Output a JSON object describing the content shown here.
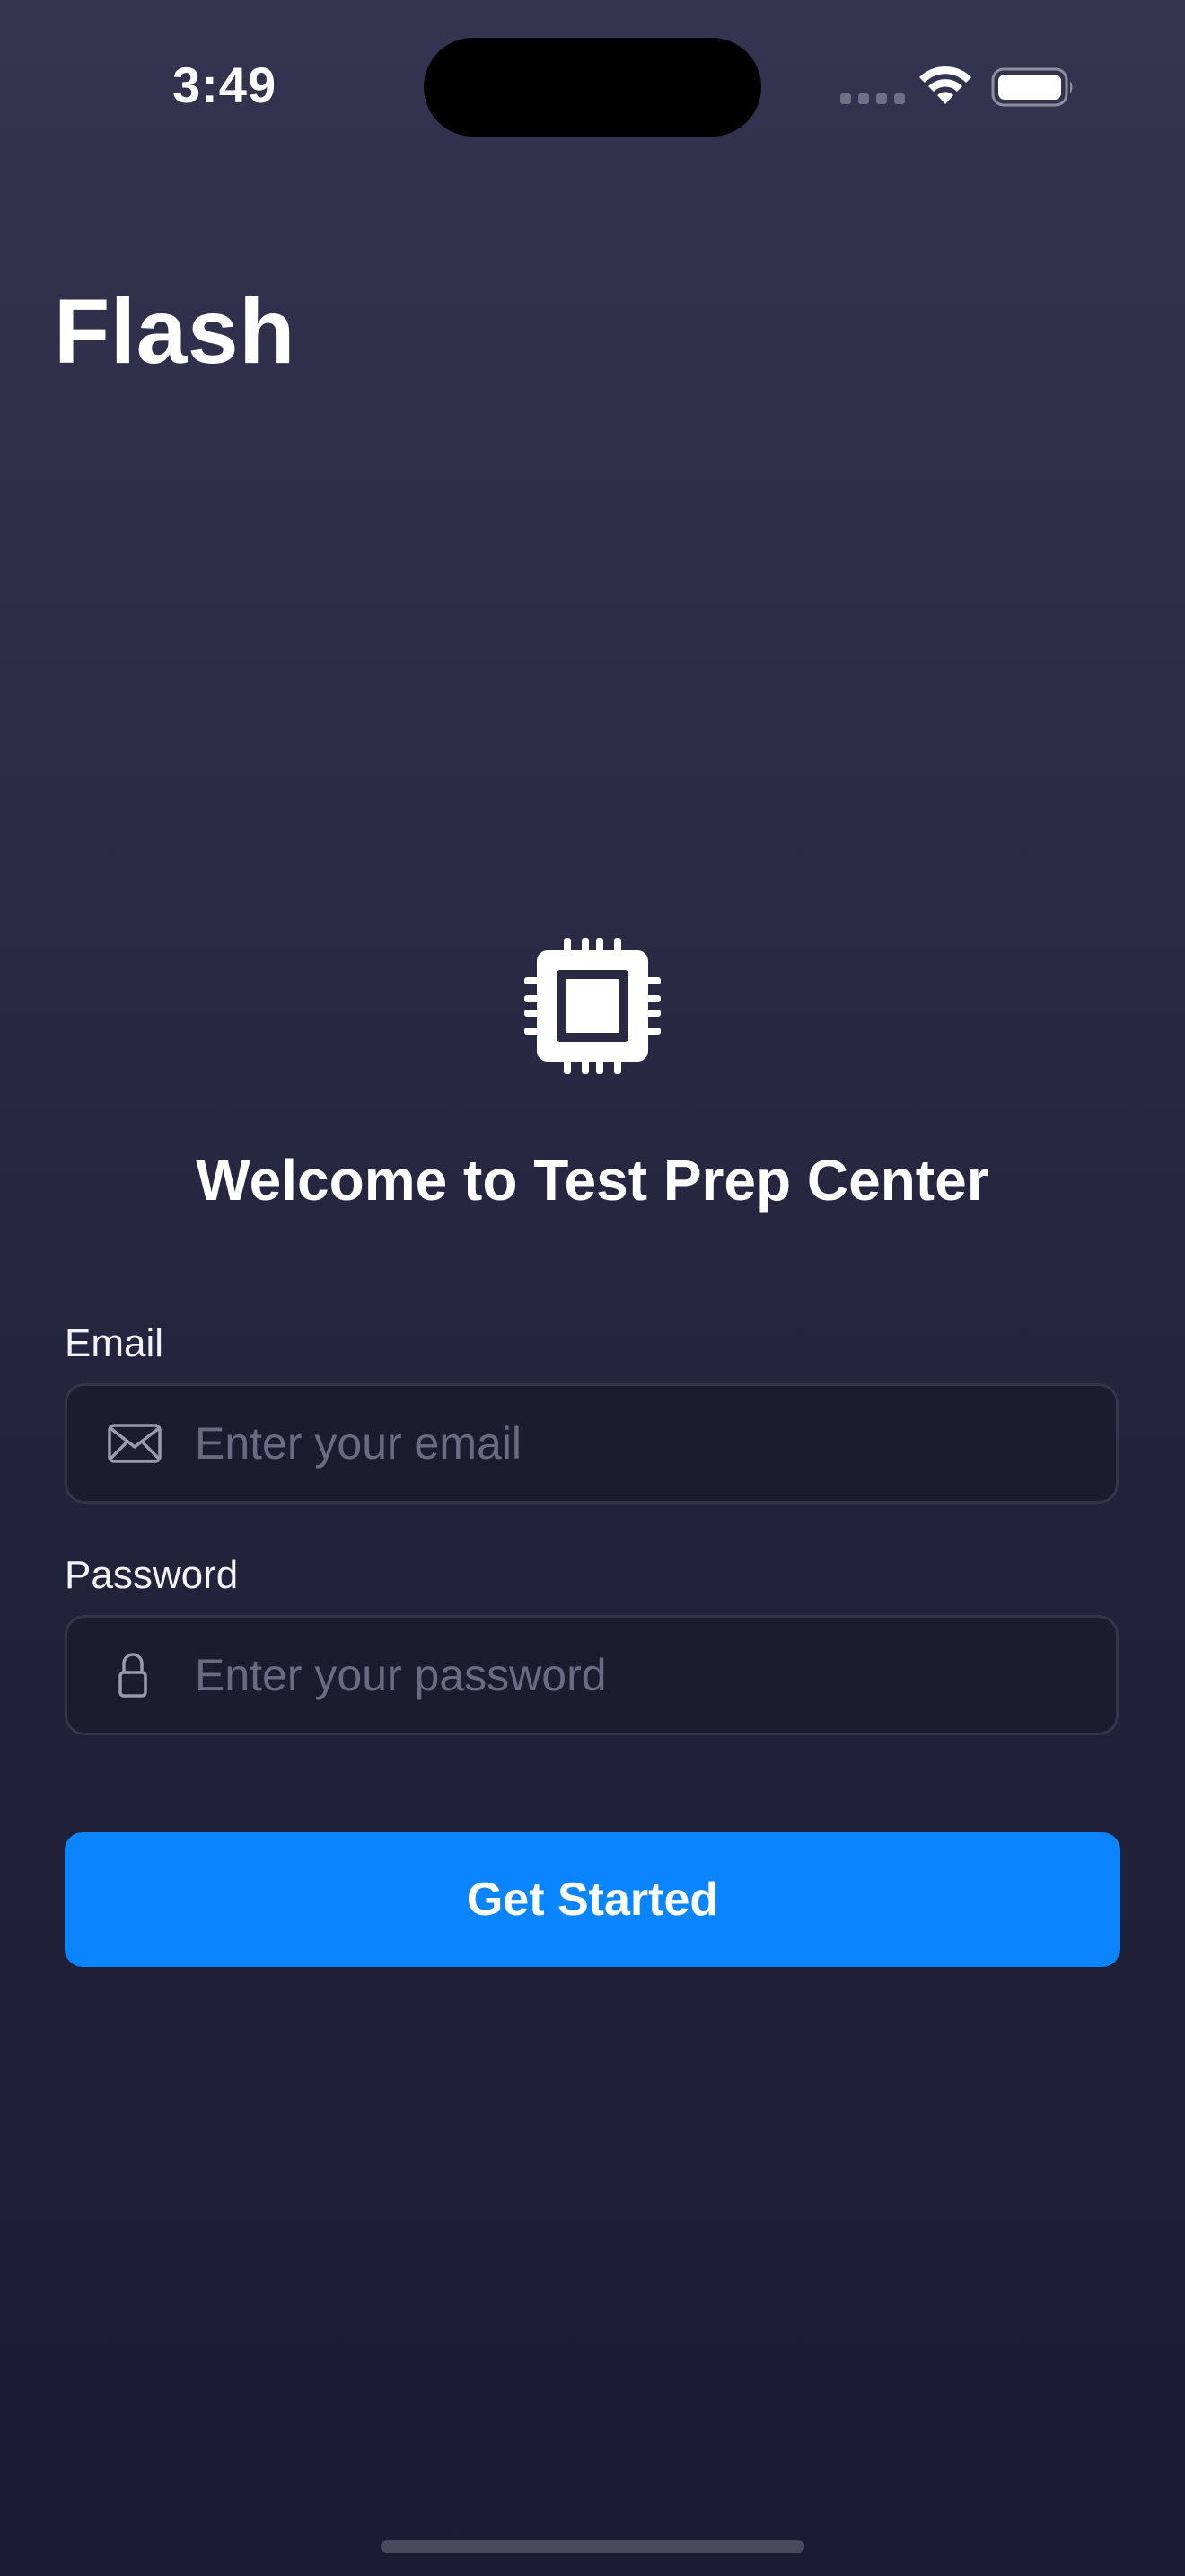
{
  "status_bar": {
    "time": "3:49",
    "signal_icon": "cellular-signal-icon",
    "wifi_icon": "wifi-icon",
    "battery_icon": "battery-icon"
  },
  "header": {
    "title": "Flash"
  },
  "hero": {
    "icon": "cpu-chip-icon",
    "welcome_text": "Welcome to Test Prep Center"
  },
  "form": {
    "email": {
      "label": "Email",
      "value": "",
      "placeholder": "Enter your email",
      "icon": "envelope-icon"
    },
    "password": {
      "label": "Password",
      "value": "",
      "placeholder": "Enter your password",
      "icon": "lock-icon"
    },
    "submit_label": "Get Started"
  },
  "colors": {
    "accent": "#0a84ff",
    "background_top": "#343450",
    "background_bottom": "#1c1b33",
    "input_background": "#1c1c30",
    "placeholder": "#6a6a82"
  }
}
